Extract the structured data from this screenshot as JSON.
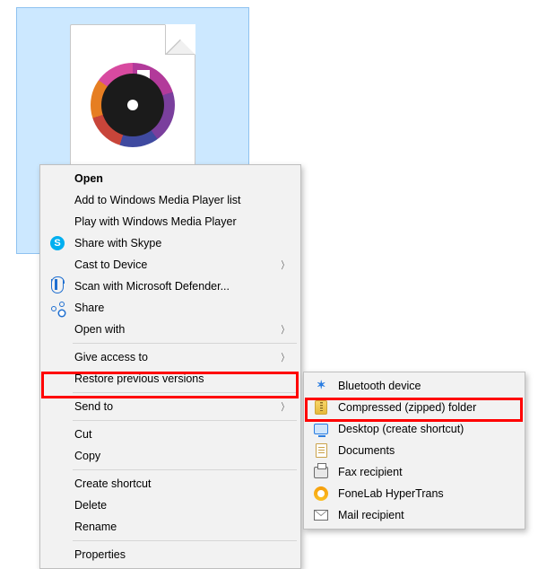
{
  "file": {
    "type_hint": "media-file"
  },
  "context_menu": {
    "open": "Open",
    "add_wmp_list": "Add to Windows Media Player list",
    "play_wmp": "Play with Windows Media Player",
    "share_skype": "Share with Skype",
    "cast": "Cast to Device",
    "defender": "Scan with Microsoft Defender...",
    "share": "Share",
    "open_with": "Open with",
    "give_access": "Give access to",
    "restore_prev": "Restore previous versions",
    "send_to": "Send to",
    "cut": "Cut",
    "copy": "Copy",
    "create_shortcut": "Create shortcut",
    "delete": "Delete",
    "rename": "Rename",
    "properties": "Properties"
  },
  "send_to_submenu": {
    "bluetooth": "Bluetooth device",
    "compressed": "Compressed (zipped) folder",
    "desktop": "Desktop (create shortcut)",
    "documents": "Documents",
    "fax": "Fax recipient",
    "fonelab": "FoneLab HyperTrans",
    "mail": "Mail recipient"
  },
  "highlights": {
    "primary": "send_to",
    "secondary": "compressed"
  }
}
